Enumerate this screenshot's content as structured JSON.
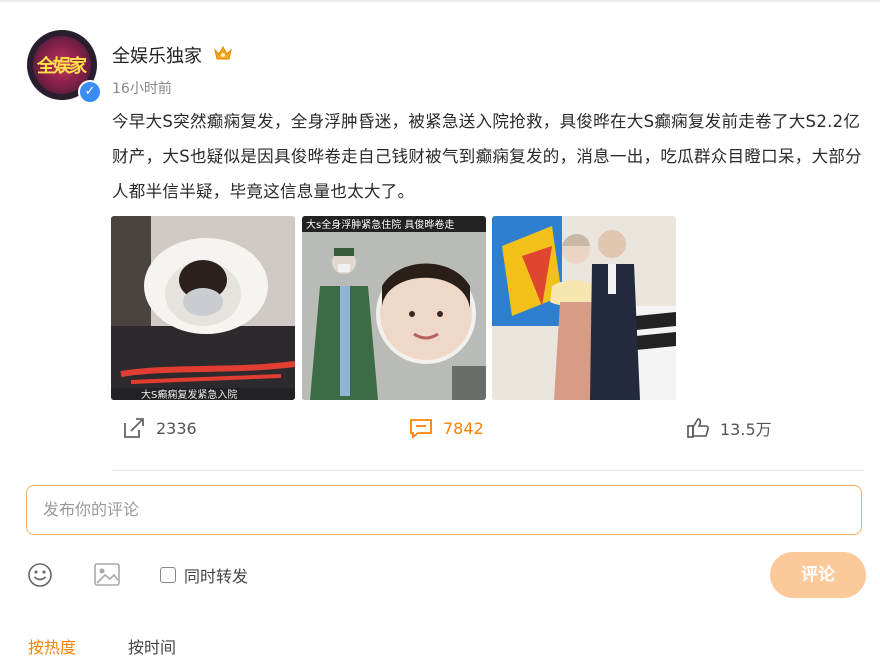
{
  "post": {
    "author": "全娱乐独家",
    "time": "16小时前",
    "text": "今早大S突然癫痫复发，全身浮肿昏迷，被紧急送入院抢救，具俊晔在大S癫痫复发前走卷了大S2.2亿财产，大S也疑似是因具俊晔卷走自己钱财被气到癫痫复发的，消息一出，吃瓜群众目瞪口呆，大部分人都半信半疑，毕竟这信息量也太大了。",
    "images": [
      {
        "caption": "大S癫痫复发紧急入院"
      },
      {
        "caption": "大s全身浮肿紧急住院 具俊晔卷走"
      },
      {
        "caption": ""
      }
    ]
  },
  "actions": {
    "repost_count": "2336",
    "comment_count": "7842",
    "like_count": "13.5万"
  },
  "comment_form": {
    "placeholder": "发布你的评论",
    "repost_label": "同时转发",
    "submit_label": "评论"
  },
  "sort": {
    "hot": "按热度",
    "time": "按时间"
  },
  "colors": {
    "accent": "#ff8200",
    "submit_bg": "#fbc99a",
    "input_border": "#f0b165"
  }
}
